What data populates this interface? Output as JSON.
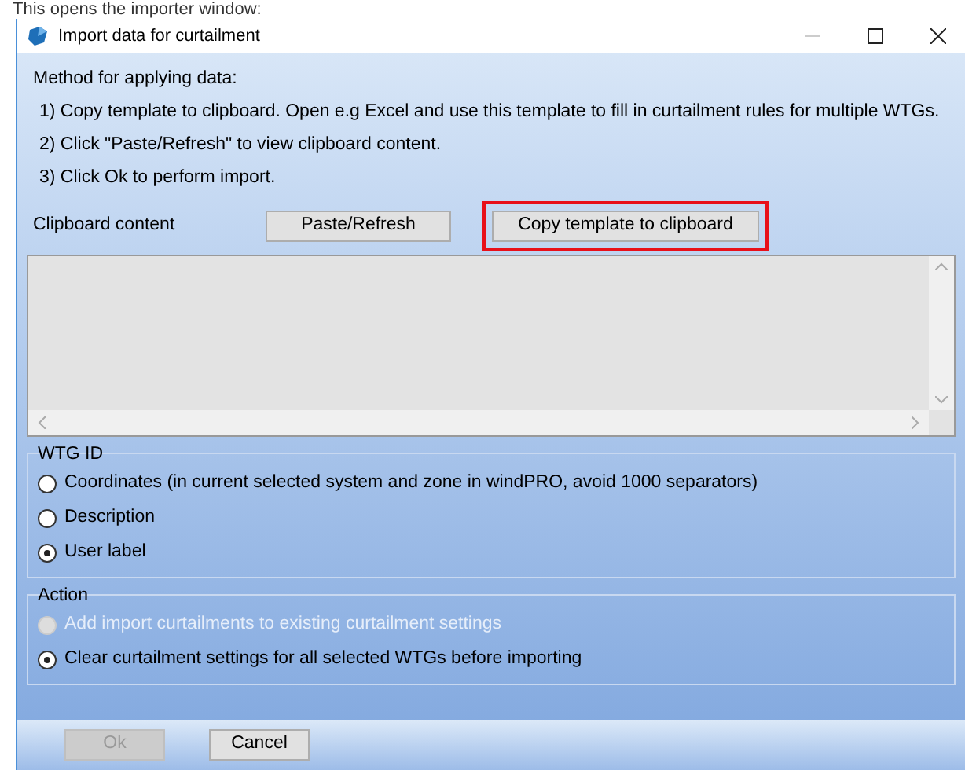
{
  "caption": "This opens the importer window:",
  "window": {
    "title": "Import data for curtailment"
  },
  "instructions": {
    "heading": "Method for applying data:",
    "steps": [
      "1) Copy template to clipboard. Open e.g Excel and use this template to fill in curtailment rules for multiple WTGs.",
      "2) Click \"Paste/Refresh\" to view clipboard content.",
      "3) Click Ok to perform import."
    ]
  },
  "clipboard": {
    "label": "Clipboard content",
    "buttons": [
      {
        "label": "Paste/Refresh",
        "highlighted": false
      },
      {
        "label": "Copy template to clipboard",
        "highlighted": true
      }
    ]
  },
  "groups": [
    {
      "title": "WTG ID",
      "options": [
        {
          "label": "Coordinates (in current selected system and zone in windPRO, avoid 1000 separators)",
          "selected": false,
          "disabled": false
        },
        {
          "label": "Description",
          "selected": false,
          "disabled": false
        },
        {
          "label": "User label",
          "selected": true,
          "disabled": false
        }
      ]
    },
    {
      "title": "Action",
      "options": [
        {
          "label": "Add import curtailments to existing curtailment settings",
          "selected": false,
          "disabled": true
        },
        {
          "label": "Clear curtailment settings for all selected WTGs before importing",
          "selected": true,
          "disabled": false
        }
      ]
    }
  ],
  "buttons": [
    {
      "label": "Ok",
      "disabled": true
    },
    {
      "label": "Cancel",
      "disabled": false
    }
  ]
}
